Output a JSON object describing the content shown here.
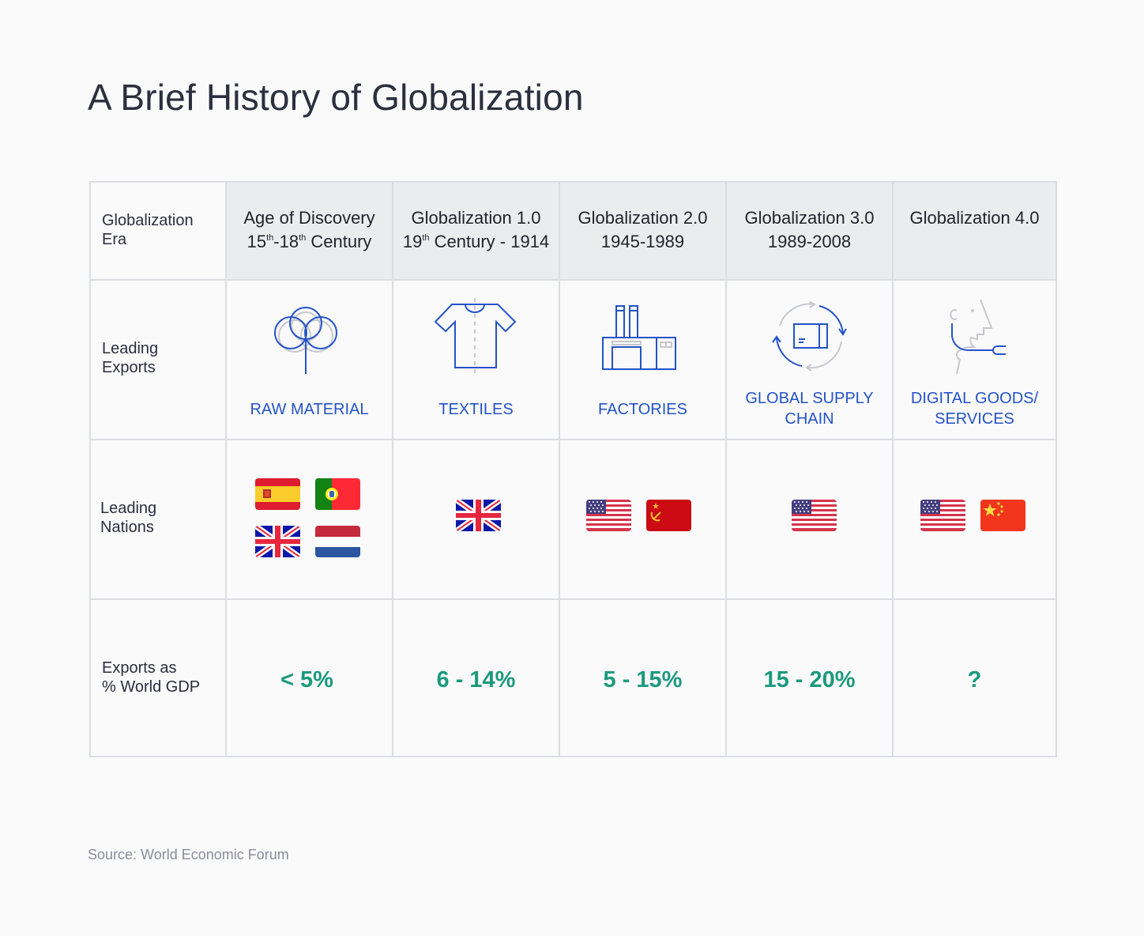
{
  "title": "A Brief History of Globalization",
  "row_labels": {
    "era": [
      "Globalization",
      "Era"
    ],
    "exports": [
      "Leading",
      "Exports"
    ],
    "nations": [
      "Leading",
      "Nations"
    ],
    "gdp": [
      "Exports as",
      "% World GDP"
    ]
  },
  "eras": [
    {
      "name": "Age of Discovery",
      "period_parts": [
        "15",
        "th",
        "-18",
        "th",
        " Century"
      ],
      "export_icon": "cotton-plant-icon",
      "export_lines": [
        "RAW MATERIAL",
        ""
      ],
      "nations": [
        {
          "name": "Spain",
          "icon": "spain-flag-icon"
        },
        {
          "name": "Portugal",
          "icon": "portugal-flag-icon"
        },
        {
          "name": "United Kingdom",
          "icon": "uk-flag-icon"
        },
        {
          "name": "Netherlands",
          "icon": "netherlands-flag-icon"
        }
      ],
      "exports_pct_gdp": "< 5%"
    },
    {
      "name": "Globalization 1.0",
      "period_parts": [
        "19",
        "th",
        " Century - 1914",
        "",
        ""
      ],
      "export_icon": "tshirt-icon",
      "export_lines": [
        "TEXTILES",
        ""
      ],
      "nations": [
        {
          "name": "United Kingdom",
          "icon": "uk-flag-icon"
        }
      ],
      "exports_pct_gdp": "6 - 14%"
    },
    {
      "name": "Globalization 2.0",
      "period_parts": [
        "1945-1989",
        "",
        "",
        "",
        ""
      ],
      "export_icon": "factory-icon",
      "export_lines": [
        "FACTORIES",
        ""
      ],
      "nations": [
        {
          "name": "United States",
          "icon": "usa-flag-icon"
        },
        {
          "name": "Soviet Union",
          "icon": "ussr-flag-icon"
        }
      ],
      "exports_pct_gdp": "5 - 15%"
    },
    {
      "name": "Globalization 3.0",
      "period_parts": [
        "1989-2008",
        "",
        "",
        "",
        ""
      ],
      "export_icon": "supply-chain-cycle-icon",
      "export_lines": [
        "GLOBAL SUPPLY",
        "CHAIN"
      ],
      "nations": [
        {
          "name": "United States",
          "icon": "usa-flag-icon"
        }
      ],
      "exports_pct_gdp": "15 - 20%"
    },
    {
      "name": "Globalization 4.0",
      "period_parts": [
        "",
        "",
        "",
        "",
        ""
      ],
      "export_icon": "headset-user-icon",
      "export_lines": [
        "DIGITAL GOODS/",
        "SERVICES"
      ],
      "nations": [
        {
          "name": "United States",
          "icon": "usa-flag-icon"
        },
        {
          "name": "China",
          "icon": "china-flag-icon"
        }
      ],
      "exports_pct_gdp": "?"
    }
  ],
  "source": "Source: World Economic Forum",
  "colors": {
    "accent_blue": "#2453c8",
    "pct_green": "#1b9a7c",
    "header_bg": "#ebecee",
    "grid": "#dcdde0"
  }
}
